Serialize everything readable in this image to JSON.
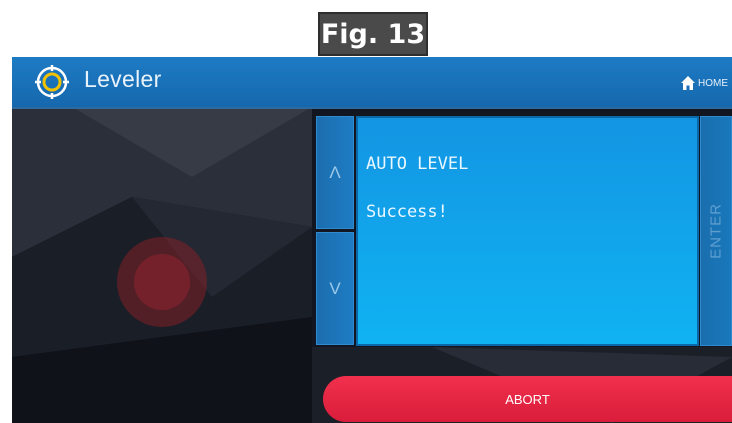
{
  "figure": {
    "label": "Fig. 13"
  },
  "app": {
    "title": "Leveler",
    "icon": "target-icon"
  },
  "header": {
    "home_label": "HOME",
    "home_icon": "home-icon"
  },
  "controls": {
    "up_label": "Λ",
    "down_label": "V",
    "enter_label": "ENTER",
    "abort_label": "ABORT"
  },
  "display": {
    "line1": "AUTO LEVEL",
    "line2": "Success!"
  },
  "colors": {
    "header": "#1a72b8",
    "display": "#10a5ec",
    "abort": "#e8263f",
    "buttons": "#1b74b6"
  }
}
